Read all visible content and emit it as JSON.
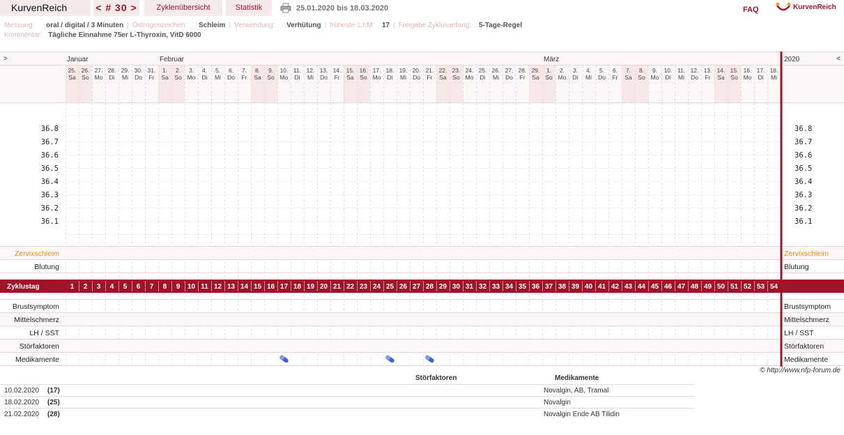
{
  "header": {
    "logo": "KurvenReich",
    "cycle_nav": "< # 30 >",
    "tab_cycles": "Zyklenübersicht",
    "tab_stats": "Statistik",
    "date_range": "25.01.2020 bis 18.03.2020",
    "faq": "FAQ",
    "brand": "KurvenReich"
  },
  "meta": {
    "messung_label": "Messung:",
    "messung_value": "oral / digital / 3 Minuten",
    "oestrogen_label": "Östrogenzeichen:",
    "oestrogen_value": "Schleim",
    "verwendung_label": "Verwendung:",
    "verwendung_value": "Verhütung",
    "hm_label": "früheste 1.hM:",
    "hm_value": "17",
    "freigabe_label": "Freigabe Zyklusanfang:",
    "freigabe_value": "5-Tage-Regel",
    "kommentar_label": "Kommentar:",
    "kommentar_value": "Tägliche Einnahme 75er L-Thyroxin, VitD 6000"
  },
  "chart": {
    "left_arrow": ">",
    "right_arrow": "<",
    "year": "2020",
    "months": [
      {
        "name": "Januar",
        "start": 0
      },
      {
        "name": "Februar",
        "start": 7
      },
      {
        "name": "März",
        "start": 36
      }
    ],
    "days": [
      {
        "d": "25.",
        "w": "Sa"
      },
      {
        "d": "26.",
        "w": "So"
      },
      {
        "d": "27.",
        "w": "Mo"
      },
      {
        "d": "28.",
        "w": "Di"
      },
      {
        "d": "29.",
        "w": "Mi"
      },
      {
        "d": "30.",
        "w": "Do"
      },
      {
        "d": "31.",
        "w": "Fr"
      },
      {
        "d": "1.",
        "w": "Sa"
      },
      {
        "d": "2.",
        "w": "So"
      },
      {
        "d": "3.",
        "w": "Mo"
      },
      {
        "d": "4.",
        "w": "Di"
      },
      {
        "d": "5.",
        "w": "Mi"
      },
      {
        "d": "6.",
        "w": "Do"
      },
      {
        "d": "7.",
        "w": "Fr"
      },
      {
        "d": "8.",
        "w": "Sa"
      },
      {
        "d": "9.",
        "w": "So"
      },
      {
        "d": "10.",
        "w": "Mo"
      },
      {
        "d": "11.",
        "w": "Di"
      },
      {
        "d": "12.",
        "w": "Mi"
      },
      {
        "d": "13.",
        "w": "Do"
      },
      {
        "d": "14.",
        "w": "Fr"
      },
      {
        "d": "15.",
        "w": "Sa"
      },
      {
        "d": "16.",
        "w": "So"
      },
      {
        "d": "17.",
        "w": "Mo"
      },
      {
        "d": "18.",
        "w": "Di"
      },
      {
        "d": "19.",
        "w": "Mi"
      },
      {
        "d": "20.",
        "w": "Do"
      },
      {
        "d": "21.",
        "w": "Fr"
      },
      {
        "d": "22.",
        "w": "Sa"
      },
      {
        "d": "23.",
        "w": "So"
      },
      {
        "d": "24.",
        "w": "Mo"
      },
      {
        "d": "25.",
        "w": "Di"
      },
      {
        "d": "26.",
        "w": "Mi"
      },
      {
        "d": "27.",
        "w": "Do"
      },
      {
        "d": "28.",
        "w": "Fr"
      },
      {
        "d": "29.",
        "w": "Sa"
      },
      {
        "d": "1.",
        "w": "So"
      },
      {
        "d": "2.",
        "w": "Mo"
      },
      {
        "d": "3.",
        "w": "Di"
      },
      {
        "d": "4.",
        "w": "Mi"
      },
      {
        "d": "5.",
        "w": "Do"
      },
      {
        "d": "6.",
        "w": "Fr"
      },
      {
        "d": "7.",
        "w": "Sa"
      },
      {
        "d": "8.",
        "w": "So"
      },
      {
        "d": "9.",
        "w": "Mo"
      },
      {
        "d": "10.",
        "w": "Di"
      },
      {
        "d": "11.",
        "w": "Mi"
      },
      {
        "d": "12.",
        "w": "Do"
      },
      {
        "d": "13.",
        "w": "Fr"
      },
      {
        "d": "14.",
        "w": "Sa"
      },
      {
        "d": "15.",
        "w": "So"
      },
      {
        "d": "16.",
        "w": "Mo"
      },
      {
        "d": "17.",
        "w": "Di"
      },
      {
        "d": "18.",
        "w": "Mi"
      }
    ],
    "temps": [
      "36.8",
      "36.7",
      "36.6",
      "36.5",
      "36.4",
      "36.3",
      "36.2",
      "36.1"
    ],
    "zervix_label": "Zervixschleim",
    "blutung_label": "Blutung",
    "zyklustag_label": "Zyklustag",
    "bottom_rows": [
      "Brustsymptom",
      "Mittelschmerz",
      "LH / SST",
      "Störfaktoren",
      "Medikamente"
    ],
    "medication_days": [
      17,
      25,
      28
    ],
    "colors": {
      "accent": "#a0142a",
      "weekend": "#f6e7e8",
      "zervix": "#e08a1e",
      "pill": "#4466cc"
    }
  },
  "copyright": "© http://www.nfp-forum.de",
  "table": {
    "col_stoer": "Störfaktoren",
    "col_med": "Medikamente",
    "rows": [
      {
        "date": "10.02.2020",
        "day": "(17)",
        "med": "Novalgin, AB, Tramal"
      },
      {
        "date": "18.02.2020",
        "day": "(25)",
        "med": "Novalgin"
      },
      {
        "date": "21.02.2020",
        "day": "(28)",
        "med": "Novalgin Ende AB Tilidin"
      }
    ]
  }
}
